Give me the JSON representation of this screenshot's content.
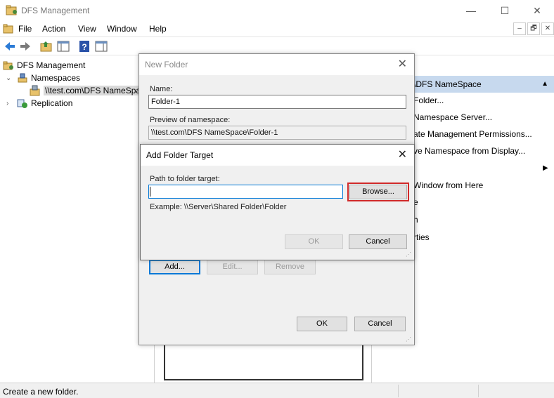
{
  "window": {
    "title": "DFS Management",
    "controls": {
      "minimize": "—",
      "maximize": "☐",
      "close": "✕"
    }
  },
  "menu": {
    "items": [
      "File",
      "Action",
      "View",
      "Window",
      "Help"
    ],
    "mdi": {
      "minimize": "–",
      "restore": "🗗",
      "close": "✕"
    }
  },
  "tree": {
    "root": "DFS Management",
    "namespaces": "Namespaces",
    "namespace_item": "\\\\test.com\\DFS NameSpa",
    "replication": "Replication"
  },
  "actions": {
    "header": "\\DFS NameSpace",
    "items": [
      "Folder...",
      "Namespace Server...",
      "ate Management Permissions...",
      "ve Namespace from Display...",
      "Window from Here",
      "e",
      "h",
      "rties"
    ]
  },
  "status": {
    "text": "Create a new folder."
  },
  "new_folder": {
    "title": "New Folder",
    "name_label": "Name:",
    "name_value": "Folder-1",
    "preview_label": "Preview of namespace:",
    "preview_value": "\\\\test.com\\DFS NameSpace\\Folder-1",
    "add_label": "Add...",
    "edit_label": "Edit...",
    "remove_label": "Remove",
    "ok_label": "OK",
    "cancel_label": "Cancel"
  },
  "add_target": {
    "title": "Add Folder Target",
    "path_label": "Path to folder target:",
    "path_value": "",
    "browse_label": "Browse...",
    "example": "Example: \\\\Server\\Shared Folder\\Folder",
    "ok_label": "OK",
    "cancel_label": "Cancel",
    "highlight_color": "#d12a2a"
  }
}
